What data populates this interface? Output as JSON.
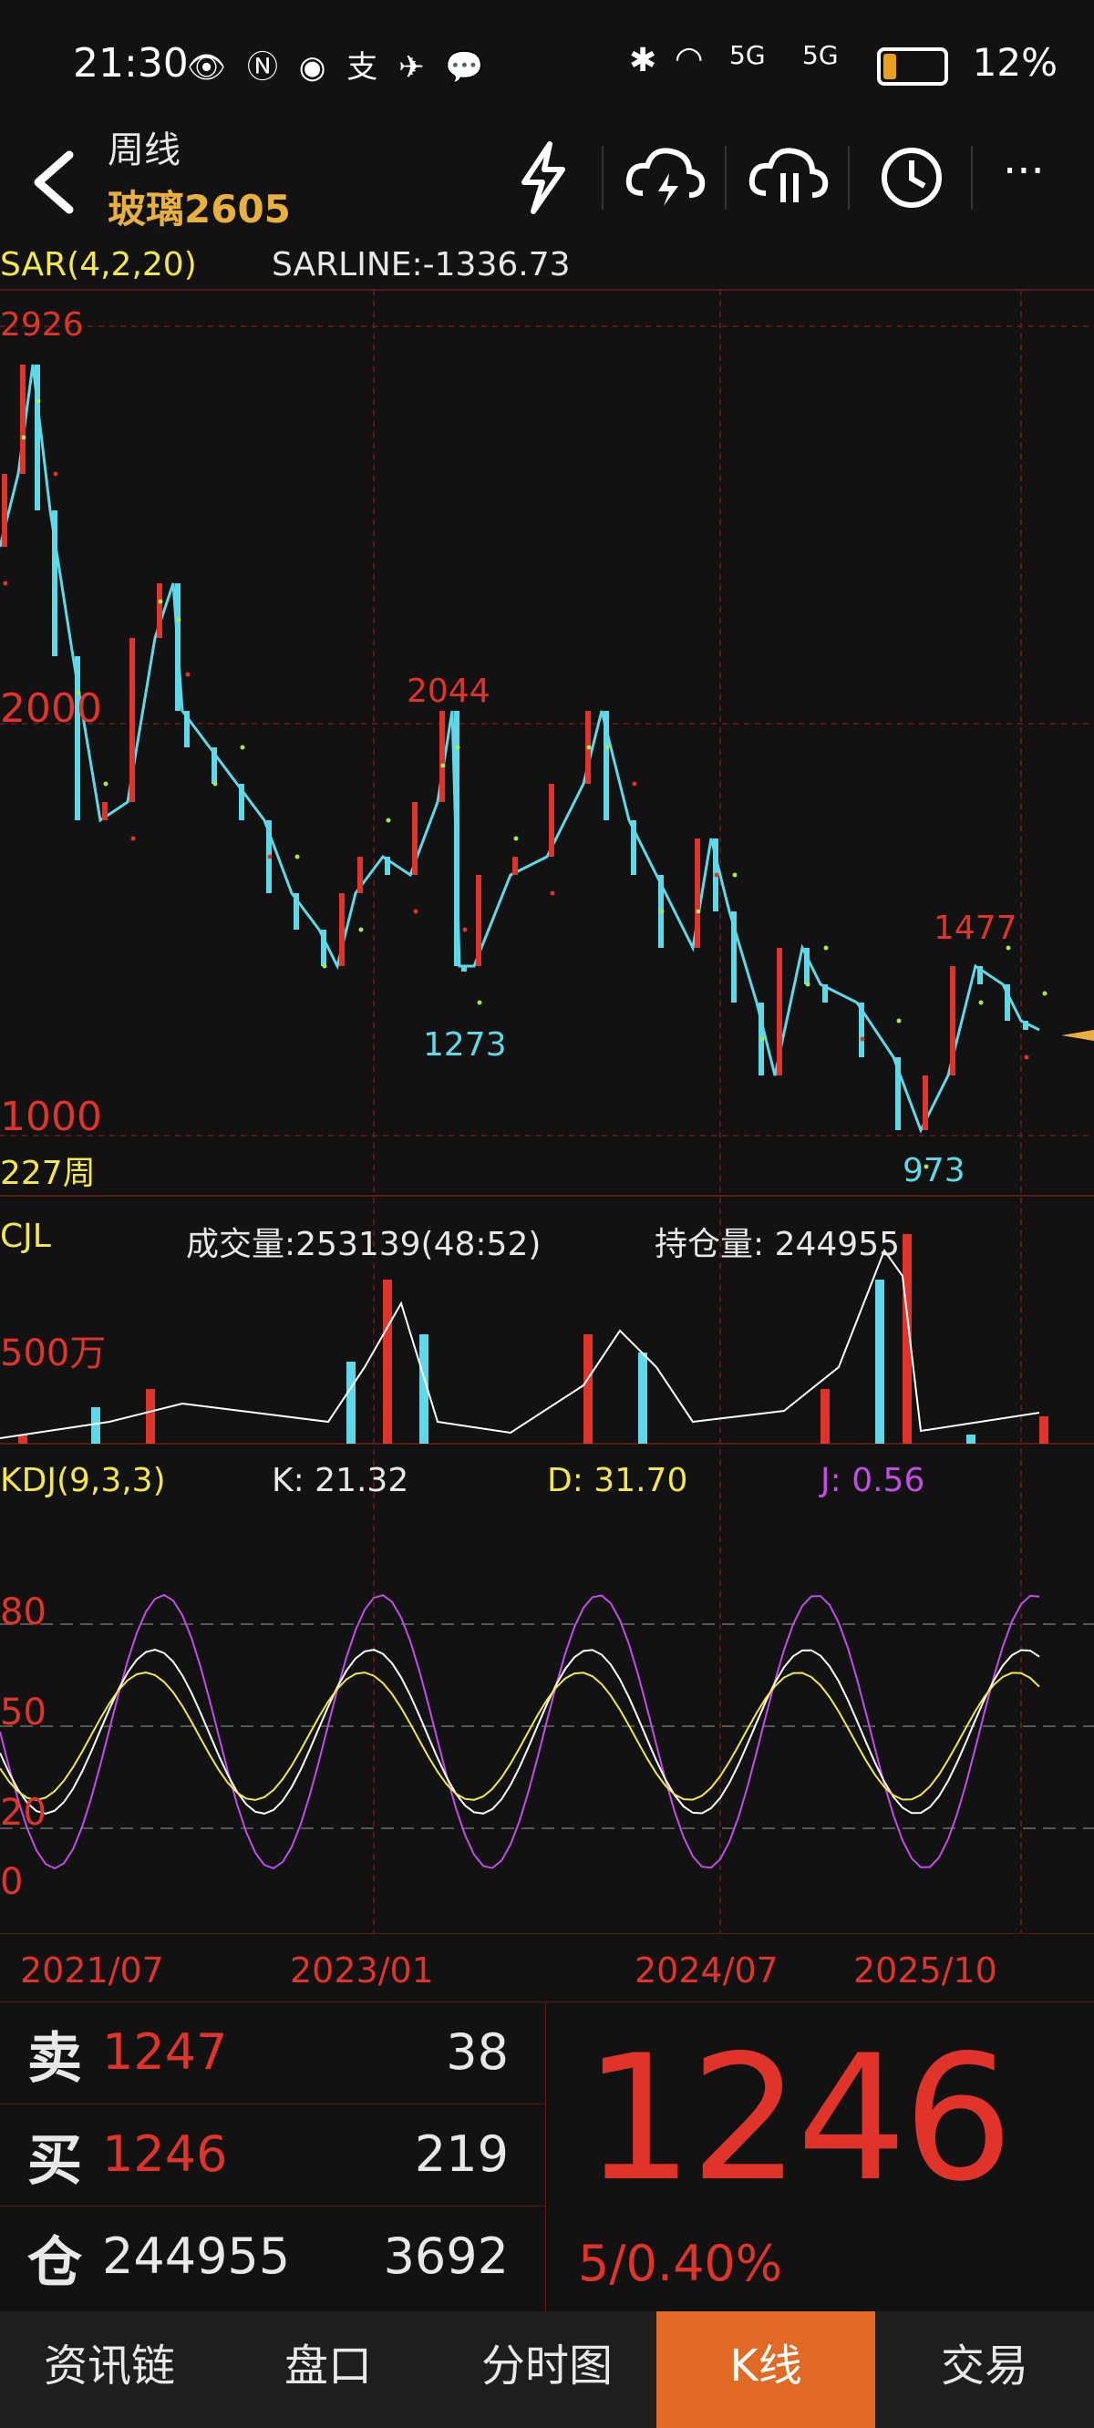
{
  "status_bar": {
    "time": "21:30",
    "network": "5G",
    "battery": "12%"
  },
  "header": {
    "period": "周线",
    "symbol": "玻璃2605"
  },
  "main_chart": {
    "indicator_label": "SAR(4,2,20)",
    "sarline": "SARLINE:-1336.73",
    "y_labels": [
      "2926",
      "2000",
      "1000"
    ],
    "annotations": {
      "peak_high": "2926",
      "mid_high": "2044",
      "mid_low": "1273",
      "low": "973",
      "recent_high": "1477"
    },
    "period_count": "227周"
  },
  "volume_chart": {
    "label": "CJL",
    "volume": "成交量:253139(48:52)",
    "open_interest": "持仓量: 244955",
    "y_label": "500万"
  },
  "kdj_chart": {
    "label": "KDJ(9,3,3)",
    "k": "K: 21.32",
    "d": "D: 31.70",
    "j": "J: 0.56",
    "y_labels": [
      "80",
      "50",
      "20",
      "0"
    ]
  },
  "x_dates": [
    "2021/07",
    "2023/01",
    "2024/07",
    "2025/10"
  ],
  "quote": {
    "sell_label": "卖",
    "sell_price": "1247",
    "sell_qty": "38",
    "buy_label": "买",
    "buy_price": "1246",
    "buy_qty": "219",
    "oi_label": "仓",
    "oi_value": "244955",
    "oi_change": "3692",
    "last_price": "1246",
    "change": "5/0.40%"
  },
  "bottom_nav": [
    "资讯链",
    "盘口",
    "分时图",
    "K线",
    "交易"
  ],
  "colors": {
    "up": "#e0342b",
    "down": "#5fd8e8",
    "accent": "#e06a25",
    "gold": "#e8b03c"
  }
}
